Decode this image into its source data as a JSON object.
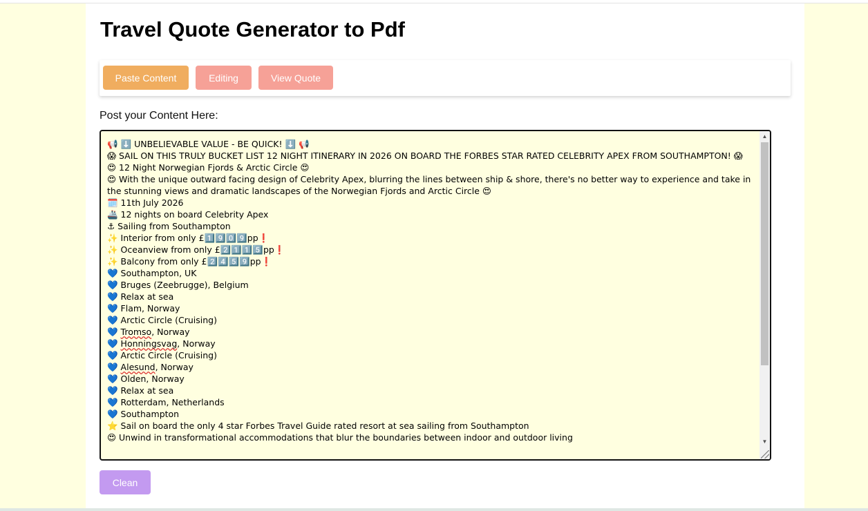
{
  "page": {
    "title": "Travel Quote Generator to Pdf"
  },
  "nav": {
    "paste_label": "Paste Content",
    "editing_label": "Editing",
    "view_quote_label": "View Quote"
  },
  "content": {
    "label": "Post your Content Here:",
    "lines": [
      "📢 ⬇️ UNBELIEVABLE VALUE - BE QUICK! ⬇️ 📢",
      "😱 SAIL ON THIS TRULY BUCKET LIST 12 NIGHT ITINERARY IN 2026 ON BOARD THE FORBES STAR RATED CELEBRITY APEX FROM SOUTHAMPTON! 😱",
      "😍 12 Night Norwegian Fjords & Arctic Circle 😍",
      "😍 With the unique outward facing design of Celebrity Apex, blurring the lines between ship & shore, there's no better way to experience and take in the stunning views and dramatic landscapes of the Norwegian Fjords and Arctic Circle 😍",
      "🗓️ 11th July 2026",
      "🚢 12 nights on board Celebrity Apex",
      "⚓ Sailing from Southampton",
      "✨ Interior from only £1️⃣9️⃣0️⃣9️⃣pp❗",
      "✨ Oceanview from only £2️⃣1️⃣1️⃣5️⃣pp❗",
      "✨ Balcony from only £2️⃣4️⃣5️⃣9️⃣pp❗",
      "💙 Southampton, UK",
      "💙 Bruges (Zeebrugge), Belgium",
      "💙 Relax at sea",
      "💙 Flam, Norway",
      "💙 Arctic Circle (Cruising)",
      "💙 Tromso, Norway",
      "💙 Honningsvag, Norway",
      "💙 Arctic Circle (Cruising)",
      "💙 Alesund, Norway",
      "💙 Olden, Norway",
      "💙 Relax at sea",
      "💙 Rotterdam, Netherlands",
      "💙 Southampton",
      "⭐ Sail on board the only 4 star Forbes Travel Guide rated resort at sea sailing from Southampton",
      "😍 Unwind in transformational accommodations that blur the boundaries between indoor and outdoor living"
    ]
  },
  "actions": {
    "clean_label": "Clean"
  },
  "colors": {
    "background": "#ffffe0",
    "paste_button": "#f0ad5f",
    "nav_button": "#f6a197",
    "clean_button": "#c39af0"
  },
  "icons": {
    "scroll_up": "▲",
    "scroll_down": "▼"
  }
}
